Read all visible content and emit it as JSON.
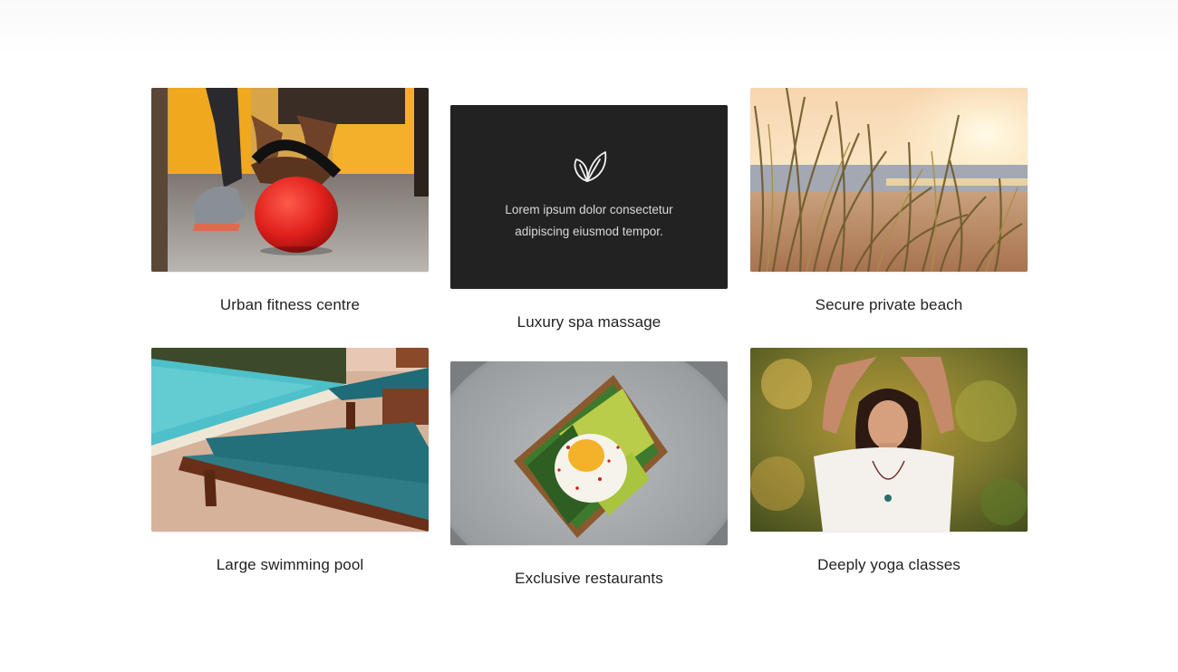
{
  "cards": [
    {
      "caption": "Urban fitness centre",
      "image_icon": "kettlebell-photo"
    },
    {
      "caption": "Luxury spa massage",
      "image_icon": "leaf-icon",
      "overlay_text": "Lorem ipsum dolor consectetur adipiscing eiusmod tempor.",
      "tile_color": "#222222"
    },
    {
      "caption": "Secure private beach",
      "image_icon": "beach-photo"
    },
    {
      "caption": "Large swimming pool",
      "image_icon": "pool-photo"
    },
    {
      "caption": "Exclusive restaurants",
      "image_icon": "food-photo"
    },
    {
      "caption": "Deeply yoga classes",
      "image_icon": "yoga-photo"
    }
  ]
}
